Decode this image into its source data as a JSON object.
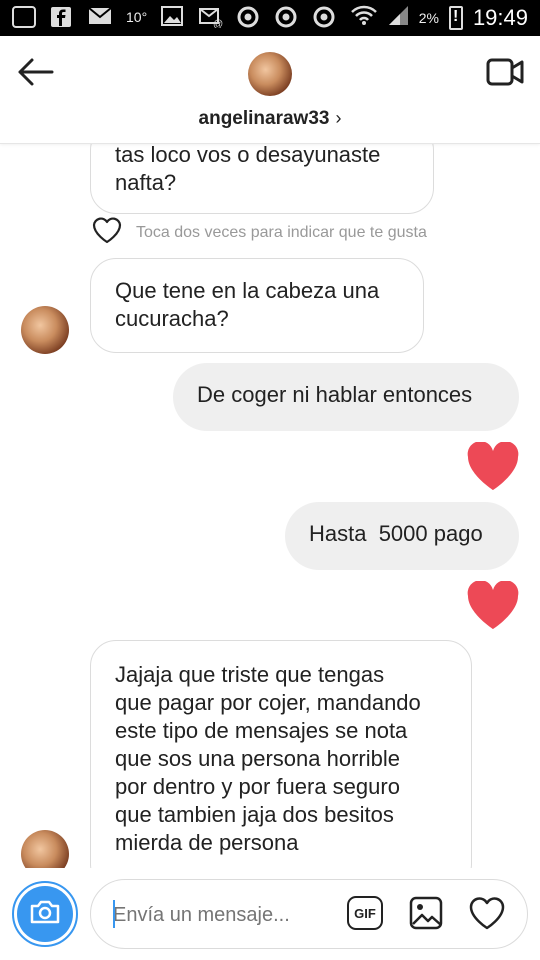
{
  "status_bar": {
    "temperature": "10°",
    "battery": "2%",
    "time": "19:49"
  },
  "header": {
    "username": "angelinaraw33",
    "chevron": "›"
  },
  "messages": [
    {
      "side": "incoming",
      "text_lines": [
        "tas loco vos o desayunaste",
        "nafta?"
      ]
    },
    {
      "side": "hint",
      "text": "Toca dos veces para indicar que te gusta"
    },
    {
      "side": "incoming",
      "text_lines": [
        "Que tene en la cabeza una",
        "cucuracha?"
      ]
    },
    {
      "side": "outgoing",
      "text": "De coger ni hablar entonces",
      "reaction": "heart"
    },
    {
      "side": "outgoing",
      "text": "Hasta  5000 pago",
      "reaction": "heart"
    },
    {
      "side": "incoming",
      "text_lines": [
        "Jajaja que triste que tengas",
        "que pagar por cojer, mandando",
        "este tipo de mensajes se nota",
        "que sos una persona horrible",
        "por dentro y por fuera seguro",
        "que tambien jaja dos besitos",
        "mierda de persona"
      ]
    }
  ],
  "composer": {
    "placeholder": "Envía un mensaje...",
    "gif_label": "GIF"
  },
  "colors": {
    "accent": "#3897f0",
    "heart": "#ed4956",
    "outgoing_bubble": "#efefef"
  }
}
